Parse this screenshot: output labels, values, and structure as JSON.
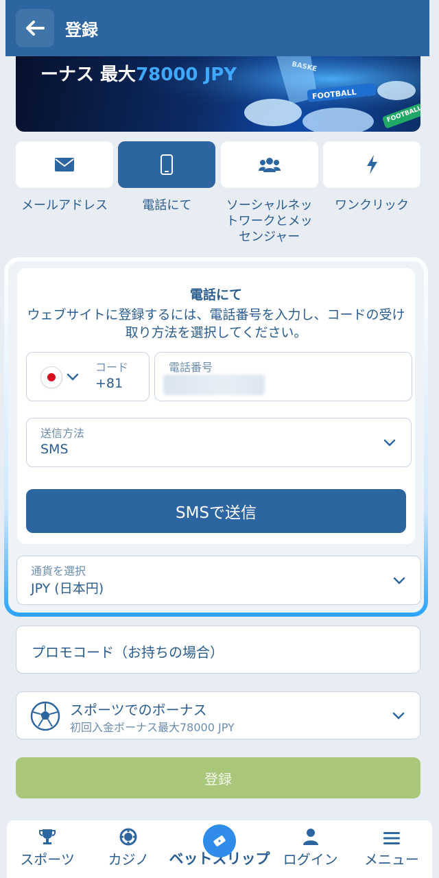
{
  "header": {
    "title": "登録"
  },
  "banner": {
    "text_prefix": "ーナス 最大",
    "text_highlight": "78000 JPY",
    "tags": [
      "BASKE",
      "FOOTBALL",
      "FOOTBALL"
    ]
  },
  "tabs": [
    {
      "label": "メールアドレス",
      "icon": "envelope-icon",
      "active": false
    },
    {
      "label": "電話にて",
      "icon": "phone-icon",
      "active": true
    },
    {
      "label": "ソーシャルネットワークとメッセンジャー",
      "icon": "users-icon",
      "active": false
    },
    {
      "label": "ワンクリック",
      "icon": "lightning-icon",
      "active": false
    }
  ],
  "form": {
    "title": "電話にて",
    "description": "ウェブサイトに登録するには、電話番号を入力し、コードの受け取り方法を選択してください。",
    "code_label": "コード",
    "code_value": "+81",
    "country_flag": "japan-flag",
    "phone_label": "電話番号",
    "send_method_label": "送信方法",
    "send_method_value": "SMS",
    "send_button": "SMSで送信",
    "currency_label": "通貨を選択",
    "currency_value": "JPY (日本円)"
  },
  "promo": {
    "placeholder": "プロモコード（お持ちの場合）"
  },
  "bonus": {
    "title": "スポーツでのボーナス",
    "subtitle": "初回入金ボーナス最大78000 JPY"
  },
  "register_button": "登録",
  "nav": [
    {
      "label": "スポーツ",
      "icon": "trophy-icon"
    },
    {
      "label": "カジノ",
      "icon": "casino-chip-icon"
    },
    {
      "label": "ベットスリップ",
      "icon": "ticket-icon"
    },
    {
      "label": "ログイン",
      "icon": "user-icon"
    },
    {
      "label": "メニュー",
      "icon": "menu-icon"
    }
  ],
  "colors": {
    "primary": "#2c65a0",
    "text": "#2b5c8f",
    "register_disabled": "#a8c77a",
    "accent_blue": "#2f8ce8"
  }
}
